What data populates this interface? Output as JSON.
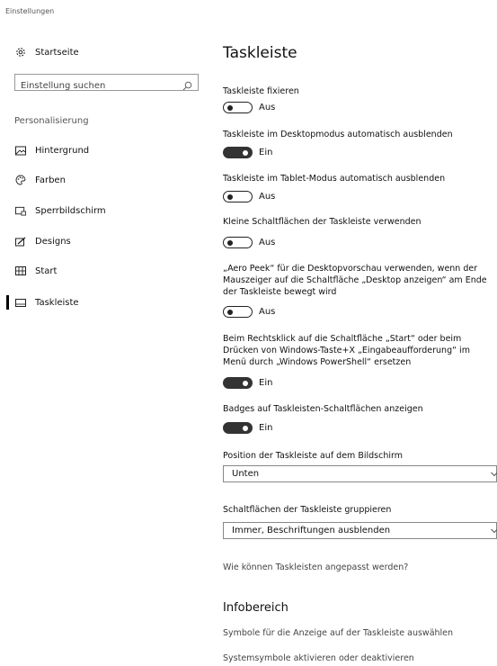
{
  "window": {
    "title": "Einstellungen"
  },
  "sidebar": {
    "home_label": "Startseite",
    "home_icon": "gear-icon",
    "search_placeholder": "Einstellung suchen",
    "section_heading": "Personalisierung",
    "items": [
      {
        "label": "Hintergrund",
        "icon": "picture-icon",
        "active": false
      },
      {
        "label": "Farben",
        "icon": "palette-icon",
        "active": false
      },
      {
        "label": "Sperrbildschirm",
        "icon": "lock-screen-icon",
        "active": false
      },
      {
        "label": "Designs",
        "icon": "brush-icon",
        "active": false
      },
      {
        "label": "Start",
        "icon": "start-grid-icon",
        "active": false
      },
      {
        "label": "Taskleiste",
        "icon": "taskbar-icon",
        "active": true
      }
    ]
  },
  "main": {
    "title": "Taskleiste",
    "settings": [
      {
        "label": "Taskleiste fixieren",
        "state": "Aus",
        "on": false
      },
      {
        "label": "Taskleiste im Desktopmodus automatisch ausblenden",
        "state": "Ein",
        "on": true
      },
      {
        "label": "Taskleiste im Tablet-Modus automatisch ausblenden",
        "state": "Aus",
        "on": false
      },
      {
        "label": "Kleine Schaltflächen der Taskleiste verwenden",
        "state": "Aus",
        "on": false
      },
      {
        "label": "„Aero Peek“ für die Desktopvorschau verwenden, wenn der Mauszeiger auf die Schaltfläche „Desktop anzeigen“ am Ende der Taskleiste bewegt wird",
        "state": "Aus",
        "on": false
      },
      {
        "label": "Beim Rechtsklick auf die Schaltfläche „Start“ oder beim Drücken von Windows-Taste+X „Eingabeaufforderung“ im Menü durch „Windows PowerShell“ ersetzen",
        "state": "Ein",
        "on": true
      },
      {
        "label": "Badges auf Taskleisten-Schaltflächen anzeigen",
        "state": "Ein",
        "on": true
      }
    ],
    "position": {
      "label": "Position der Taskleiste auf dem Bildschirm",
      "value": "Unten"
    },
    "grouping": {
      "label": "Schaltflächen der Taskleiste gruppieren",
      "value": "Immer, Beschriftungen ausblenden"
    },
    "help_link": "Wie können Taskleisten angepasst werden?",
    "notification_area": {
      "title": "Infobereich",
      "links": [
        "Symbole für die Anzeige auf der Taskleiste auswählen",
        "Systemsymbole aktivieren oder deaktivieren"
      ]
    }
  }
}
